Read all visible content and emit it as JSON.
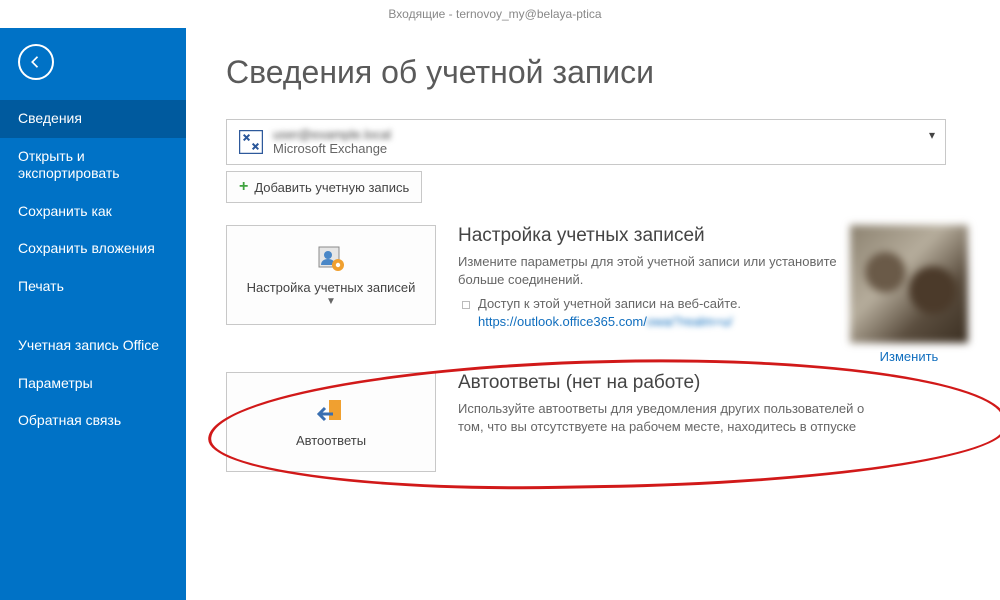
{
  "titlebar": "Входящие - ternovoy_my@belaya-ptica",
  "sidebar": {
    "items": [
      {
        "label": "Сведения",
        "selected": true
      },
      {
        "label": "Открыть и экспортировать"
      },
      {
        "label": "Сохранить как"
      },
      {
        "label": "Сохранить вложения"
      },
      {
        "label": "Печать"
      },
      {
        "label": "Учетная запись Office"
      },
      {
        "label": "Параметры"
      },
      {
        "label": "Обратная связь"
      }
    ]
  },
  "page": {
    "title": "Сведения об учетной записи"
  },
  "account": {
    "email": "user@example.local",
    "type": "Microsoft Exchange",
    "add_label": "Добавить учетную запись"
  },
  "settings_section": {
    "tile_label": "Настройка учетных записей",
    "title": "Настройка учетных записей",
    "desc": "Измените параметры для этой учетной записи или установите больше соединений.",
    "bullet_text": "Доступ к этой учетной записи на веб-сайте.",
    "link_visible": "https://outlook.office365.com/",
    "link_obscured": "owa/?realm=u/"
  },
  "profile": {
    "change_label": "Изменить"
  },
  "auto_section": {
    "tile_label": "Автоответы",
    "title": "Автоответы (нет на работе)",
    "desc": "Используйте автоответы для уведомления других пользователей о том, что вы отсутствуете на рабочем месте, находитесь в отпуске"
  }
}
